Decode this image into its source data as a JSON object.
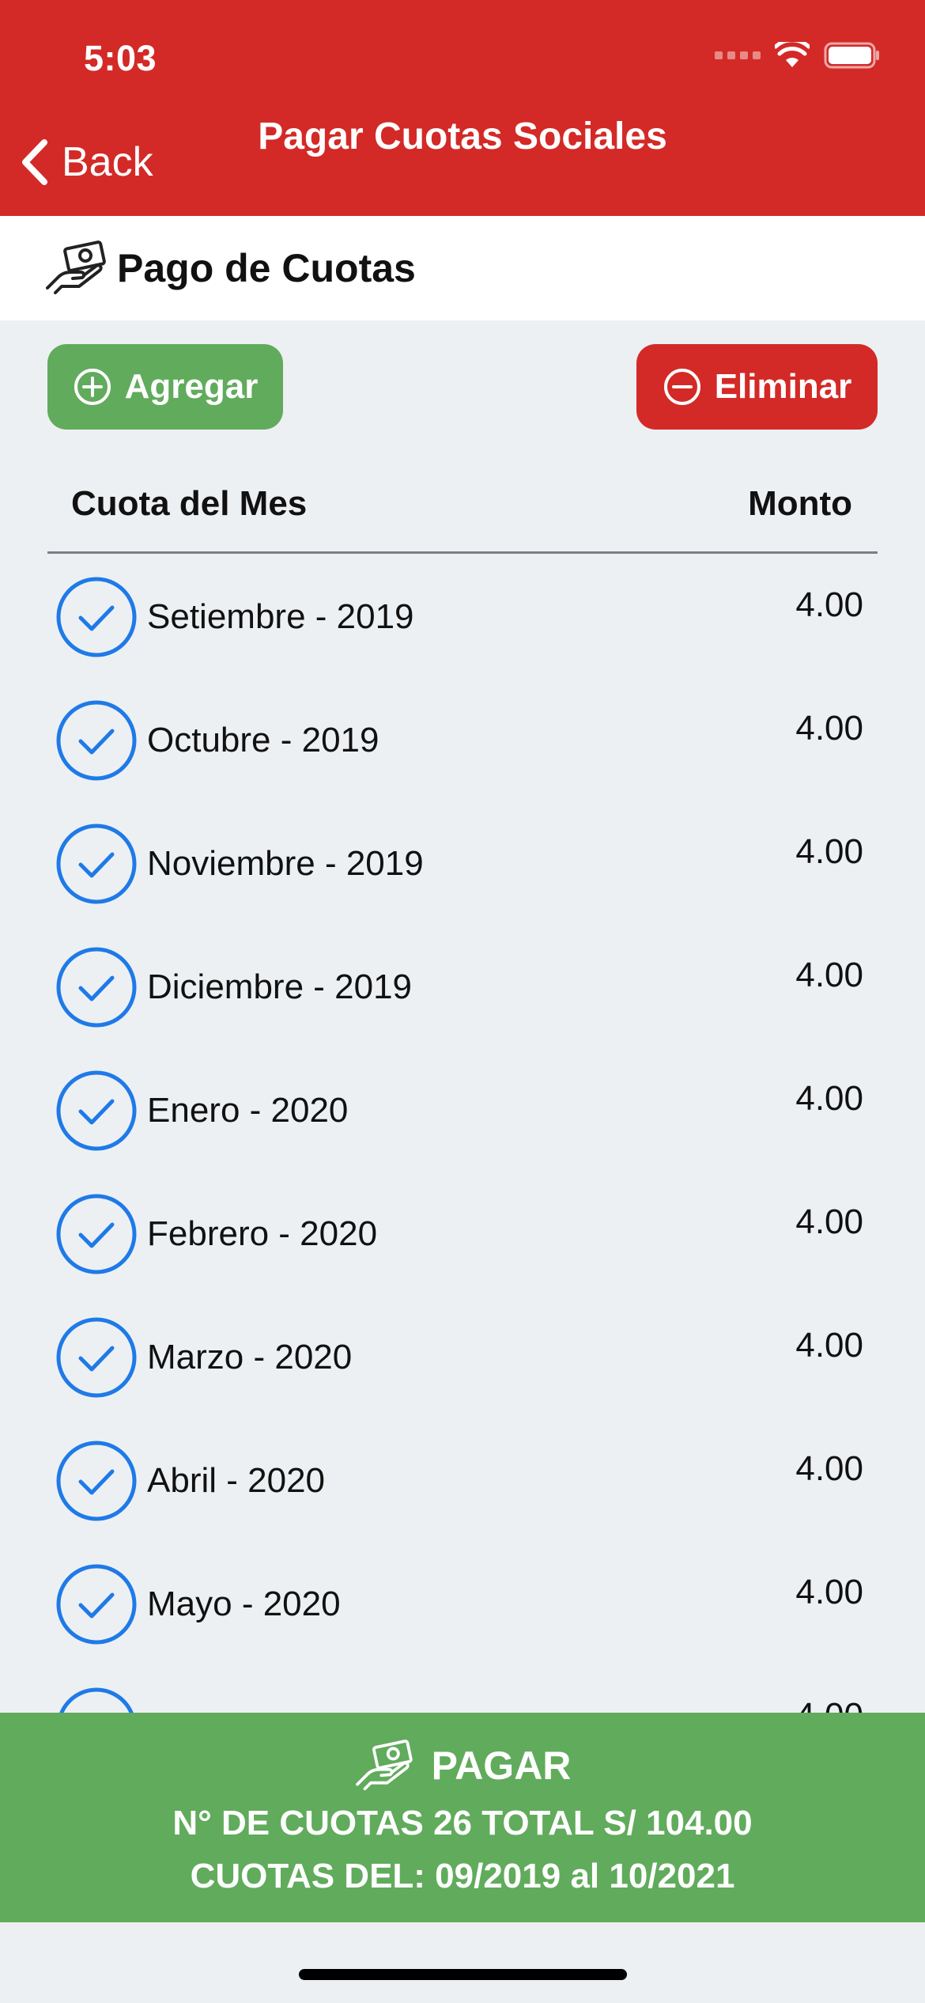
{
  "status_bar": {
    "time": "5:03"
  },
  "nav": {
    "back_label": "Back",
    "title": "Pagar Cuotas Sociales"
  },
  "section": {
    "title": "Pago de Cuotas",
    "icon": "hand-money-icon"
  },
  "actions": {
    "add_label": "Agregar",
    "remove_label": "Eliminar"
  },
  "table": {
    "headers": {
      "month": "Cuota del Mes",
      "amount": "Monto"
    },
    "rows": [
      {
        "label": "Setiembre - 2019",
        "amount": "4.00",
        "checked": true
      },
      {
        "label": "Octubre - 2019",
        "amount": "4.00",
        "checked": true
      },
      {
        "label": "Noviembre - 2019",
        "amount": "4.00",
        "checked": true
      },
      {
        "label": "Diciembre - 2019",
        "amount": "4.00",
        "checked": true
      },
      {
        "label": "Enero - 2020",
        "amount": "4.00",
        "checked": true
      },
      {
        "label": "Febrero - 2020",
        "amount": "4.00",
        "checked": true
      },
      {
        "label": "Marzo - 2020",
        "amount": "4.00",
        "checked": true
      },
      {
        "label": "Abril - 2020",
        "amount": "4.00",
        "checked": true
      },
      {
        "label": "Mayo - 2020",
        "amount": "4.00",
        "checked": true
      },
      {
        "label": "",
        "amount": "4.00",
        "checked": true
      }
    ]
  },
  "pay": {
    "label": "PAGAR",
    "summary": "N° DE CUOTAS 26 TOTAL S/ 104.00",
    "range": "CUOTAS DEL: 09/2019 al 10/2021"
  },
  "colors": {
    "header_red": "#d32a27",
    "green": "#61ab5c",
    "check_blue": "#1f7ae8",
    "background": "#edf0f3"
  }
}
